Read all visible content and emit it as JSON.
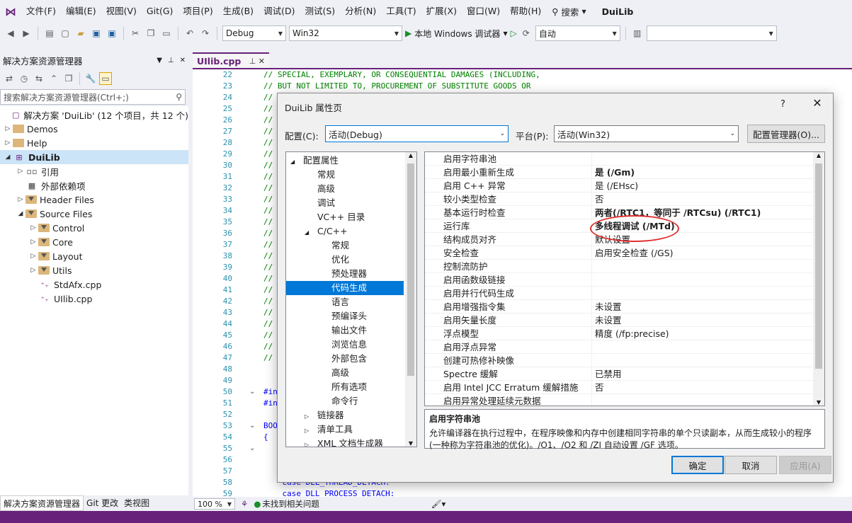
{
  "menubar": {
    "items": [
      "文件(F)",
      "编辑(E)",
      "视图(V)",
      "Git(G)",
      "项目(P)",
      "生成(B)",
      "调试(D)",
      "测试(S)",
      "分析(N)",
      "工具(T)",
      "扩展(X)",
      "窗口(W)",
      "帮助(H)"
    ],
    "search_label": "搜索",
    "solution_name": "DuiLib"
  },
  "toolbar": {
    "config": "Debug",
    "platform": "Win32",
    "run_label": "本地 Windows 调试器",
    "auto_label": "自动"
  },
  "solution_explorer": {
    "title": "解决方案资源管理器",
    "search_placeholder": "搜索解决方案资源管理器(Ctrl+;)",
    "items": [
      {
        "label": "解决方案 'DuiLib' (12 个项目，共 12 个)"
      },
      {
        "label": "Demos"
      },
      {
        "label": "Help"
      },
      {
        "label": "DuiLib"
      },
      {
        "label": "引用"
      },
      {
        "label": "外部依赖项"
      },
      {
        "label": "Header Files"
      },
      {
        "label": "Source Files"
      },
      {
        "label": "Control"
      },
      {
        "label": "Core"
      },
      {
        "label": "Layout"
      },
      {
        "label": "Utils"
      },
      {
        "label": "StdAfx.cpp"
      },
      {
        "label": "UIlib.cpp"
      }
    ],
    "tabs": [
      "解决方案资源管理器",
      "Git 更改",
      "类视图"
    ]
  },
  "editor": {
    "tab_label": "UIlib.cpp",
    "lines": [
      {
        "n": "22",
        "t": "// SPECIAL, EXEMPLARY, OR CONSEQUENTIAL DAMAGES (INCLUDING,"
      },
      {
        "n": "23",
        "t": "// BUT NOT LIMITED TO, PROCUREMENT OF SUBSTITUTE GOODS OR"
      },
      {
        "n": "24",
        "t": "// "
      },
      {
        "n": "25",
        "t": "//"
      },
      {
        "n": "26",
        "t": "//"
      },
      {
        "n": "27",
        "t": "//"
      },
      {
        "n": "28",
        "t": "//"
      },
      {
        "n": "29",
        "t": "//"
      },
      {
        "n": "30",
        "t": "//"
      },
      {
        "n": "31",
        "t": "//"
      },
      {
        "n": "32",
        "t": "//"
      },
      {
        "n": "33",
        "t": "//"
      },
      {
        "n": "34",
        "t": "//"
      },
      {
        "n": "35",
        "t": "//"
      },
      {
        "n": "36",
        "t": "//"
      },
      {
        "n": "37",
        "t": "//"
      },
      {
        "n": "38",
        "t": "//"
      },
      {
        "n": "39",
        "t": "//"
      },
      {
        "n": "40",
        "t": "//"
      },
      {
        "n": "41",
        "t": "//"
      },
      {
        "n": "42",
        "t": "//"
      },
      {
        "n": "43",
        "t": "//"
      },
      {
        "n": "44",
        "t": "//"
      },
      {
        "n": "45",
        "t": "//"
      },
      {
        "n": "46",
        "t": "//"
      },
      {
        "n": "47",
        "t": "//"
      },
      {
        "n": "48",
        "t": ""
      },
      {
        "n": "49",
        "t": ""
      },
      {
        "n": "50",
        "t": "#in"
      },
      {
        "n": "51",
        "t": "#in"
      },
      {
        "n": "52",
        "t": ""
      },
      {
        "n": "53",
        "t": "BOO"
      },
      {
        "n": "54",
        "t": "{"
      },
      {
        "n": "55",
        "t": ""
      },
      {
        "n": "56",
        "t": ""
      },
      {
        "n": "57",
        "t": ""
      },
      {
        "n": "58",
        "t": "    case DLL_THREAD_DETACH:"
      },
      {
        "n": "59",
        "t": "    case DLL_PROCESS_DETACH:"
      }
    ],
    "zoom": "100 %",
    "issues": "未找到相关问题"
  },
  "dialog": {
    "title": "DuiLib 属性页",
    "help": "?",
    "config_label": "配置(C):",
    "config_value": "活动(Debug)",
    "platform_label": "平台(P):",
    "platform_value": "活动(Win32)",
    "config_manager": "配置管理器(O)...",
    "nav": [
      {
        "label": "配置属性",
        "depth": 0,
        "exp": "◢"
      },
      {
        "label": "常规",
        "depth": 1,
        "exp": ""
      },
      {
        "label": "高级",
        "depth": 1,
        "exp": ""
      },
      {
        "label": "调试",
        "depth": 1,
        "exp": ""
      },
      {
        "label": "VC++ 目录",
        "depth": 1,
        "exp": ""
      },
      {
        "label": "C/C++",
        "depth": 1,
        "exp": "◢"
      },
      {
        "label": "常规",
        "depth": 2,
        "exp": ""
      },
      {
        "label": "优化",
        "depth": 2,
        "exp": ""
      },
      {
        "label": "预处理器",
        "depth": 2,
        "exp": ""
      },
      {
        "label": "代码生成",
        "depth": 2,
        "exp": "",
        "sel": true
      },
      {
        "label": "语言",
        "depth": 2,
        "exp": ""
      },
      {
        "label": "预编译头",
        "depth": 2,
        "exp": ""
      },
      {
        "label": "输出文件",
        "depth": 2,
        "exp": ""
      },
      {
        "label": "浏览信息",
        "depth": 2,
        "exp": ""
      },
      {
        "label": "外部包含",
        "depth": 2,
        "exp": ""
      },
      {
        "label": "高级",
        "depth": 2,
        "exp": ""
      },
      {
        "label": "所有选项",
        "depth": 2,
        "exp": ""
      },
      {
        "label": "命令行",
        "depth": 2,
        "exp": ""
      },
      {
        "label": "链接器",
        "depth": 1,
        "exp": "▷"
      },
      {
        "label": "清单工具",
        "depth": 1,
        "exp": "▷"
      },
      {
        "label": "XML 文档生成器",
        "depth": 1,
        "exp": "▷"
      }
    ],
    "props": [
      {
        "name": "启用字符串池",
        "value": "",
        "bold": false
      },
      {
        "name": "启用最小重新生成",
        "value": "是 (/Gm)",
        "bold": true
      },
      {
        "name": "启用 C++ 异常",
        "value": "是 (/EHsc)",
        "bold": false
      },
      {
        "name": "较小类型检查",
        "value": "否",
        "bold": false
      },
      {
        "name": "基本运行时检查",
        "value": "两者(/RTC1，等同于 /RTCsu) (/RTC1)",
        "bold": true
      },
      {
        "name": "运行库",
        "value": "多线程调试 (/MTd)",
        "bold": true
      },
      {
        "name": "结构成员对齐",
        "value": "默认设置",
        "bold": false
      },
      {
        "name": "安全检查",
        "value": "启用安全检查 (/GS)",
        "bold": false
      },
      {
        "name": "控制流防护",
        "value": "",
        "bold": false
      },
      {
        "name": "启用函数级链接",
        "value": "",
        "bold": false
      },
      {
        "name": "启用并行代码生成",
        "value": "",
        "bold": false
      },
      {
        "name": "启用增强指令集",
        "value": "未设置",
        "bold": false
      },
      {
        "name": "启用矢量长度",
        "value": "未设置",
        "bold": false
      },
      {
        "name": "浮点模型",
        "value": "精度 (/fp:precise)",
        "bold": false
      },
      {
        "name": "启用浮点异常",
        "value": "",
        "bold": false
      },
      {
        "name": "创建可热修补映像",
        "value": "",
        "bold": false
      },
      {
        "name": "Spectre 缓解",
        "value": "已禁用",
        "bold": false
      },
      {
        "name": "启用 Intel JCC Erratum 缓解措施",
        "value": "否",
        "bold": false
      },
      {
        "name": "启用异常处理延续元数据",
        "value": "",
        "bold": false
      }
    ],
    "desc_title": "启用字符串池",
    "desc_text": "允许编译器在执行过程中，在程序映像和内存中创建相同字符串的单个只读副本，从而生成较小的程序(一种称为字符串池的优化)。/O1、/O2 和 /ZI 自动设置 /GF 选项。",
    "ok": "确定",
    "cancel": "取消",
    "apply": "应用(A)"
  }
}
